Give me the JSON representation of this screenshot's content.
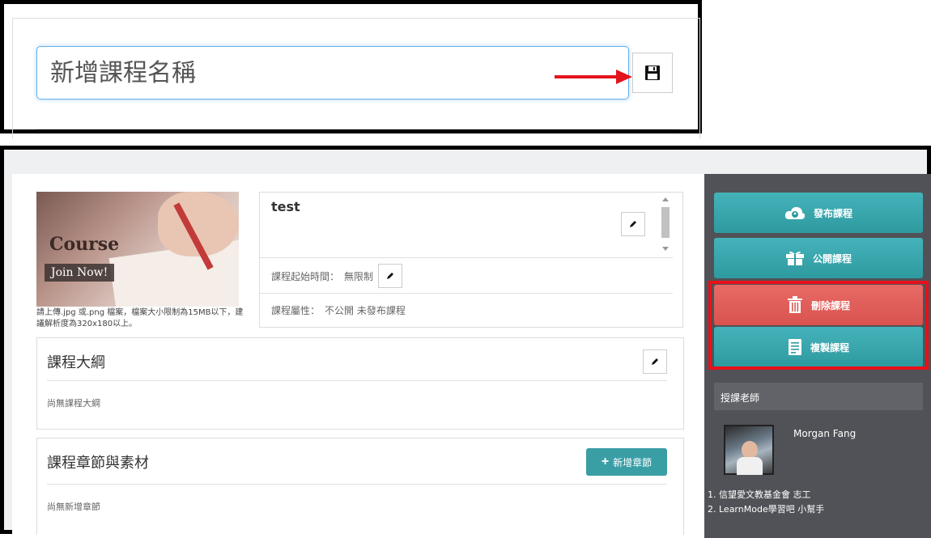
{
  "top_panel": {
    "course_name_placeholder": "新增課程名稱"
  },
  "course_info": {
    "image_word": "Course",
    "image_join": "Join Now!",
    "image_note": "請上傳.jpg 或.png 檔案，檔案大小限制為15MB以下，建議解析度為320x180以上。",
    "title": "test",
    "start_time_label": "課程起始時間：",
    "start_time_value": "無限制",
    "attribute_label": "課程屬性：",
    "attribute_value": "不公開 未發布課程"
  },
  "outline": {
    "title": "課程大綱",
    "empty_text": "尚無課程大綱"
  },
  "chapters": {
    "title": "課程章節與素材",
    "add_button": "新增章節",
    "empty_text": "尚無新增章節"
  },
  "sidebar": {
    "publish_label": "發布課程",
    "public_label": "公開課程",
    "delete_label": "刪除課程",
    "copy_label": "複製課程",
    "teacher_header": "授課老師",
    "teacher_name": "Morgan Fang",
    "teacher_roles": [
      "1. 信望愛文教基金會 志工",
      "2. LearnMode學習吧 小幫手"
    ]
  },
  "colors": {
    "teal": "#3a9ea5",
    "red": "#d9534f",
    "highlight": "#e8101a",
    "sidebar_bg": "#515257"
  },
  "icons": [
    "floppy-save-icon",
    "pencil-icon",
    "cloud-upload-icon",
    "gift-icon",
    "trash-icon",
    "document-icon",
    "plus-icon",
    "arrow-right-icon"
  ]
}
